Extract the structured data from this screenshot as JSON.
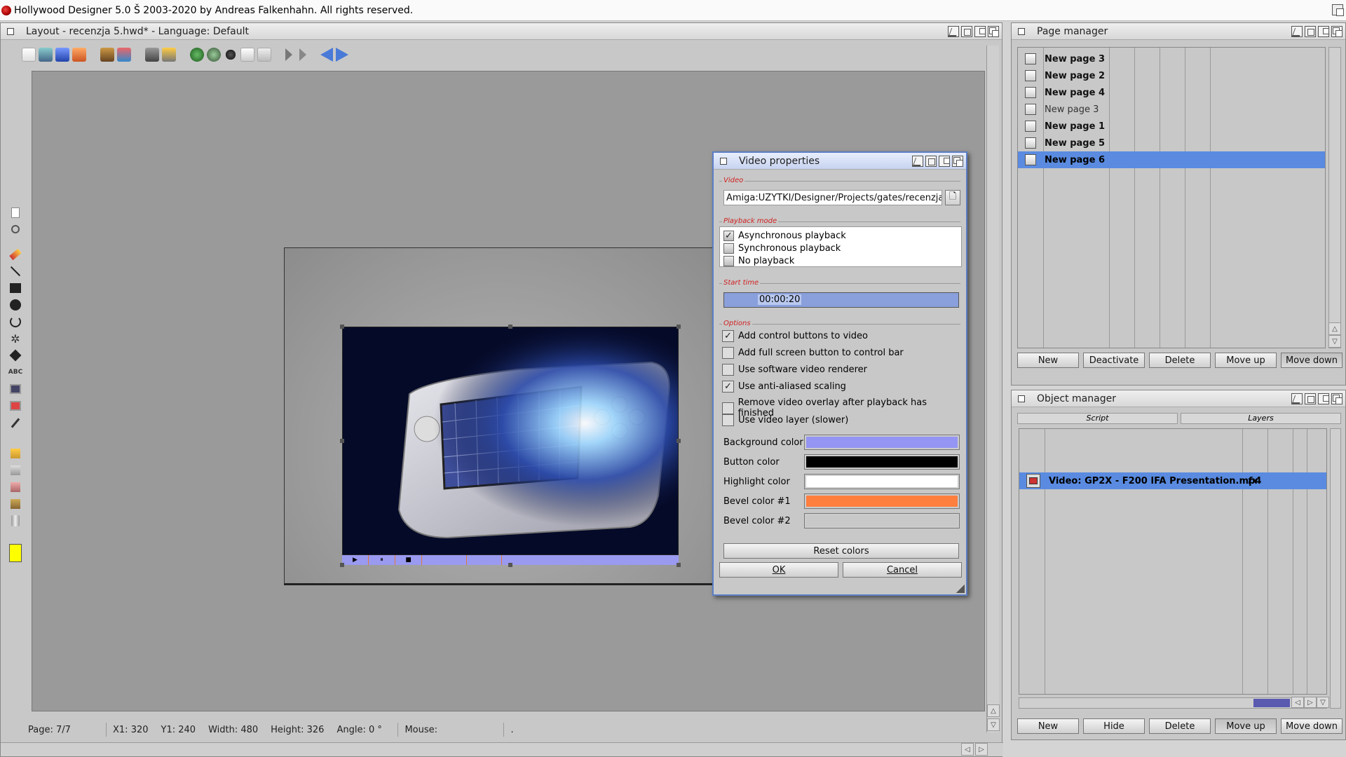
{
  "app": {
    "title": "Hollywood Designer 5.0 Š 2003-2020 by Andreas Falkenhahn. All rights reserved."
  },
  "layout": {
    "title": "Layout - recenzja 5.hwd* - Language: Default",
    "status": {
      "page": "Page:  7/7",
      "x1": "X1:  320",
      "y1": "Y1:  240",
      "width": "Width:  480",
      "height": "Height:  326",
      "angle": "Angle:  0 °",
      "mouse": "Mouse:",
      "extra": "."
    },
    "toolbar_icons": [
      "new-icon",
      "open-icon",
      "save-icon",
      "save-as-icon",
      "import-icon",
      "export-icon",
      "camera-icon",
      "snapshot-icon",
      "undo-icon",
      "redo-icon",
      "cut-icon",
      "copy-icon",
      "paste-icon",
      "play-icon",
      "play-from-icon",
      "prev-page-icon",
      "next-page-icon"
    ],
    "tool_labels": {
      "text_tool": "ABC"
    },
    "video_controls": {
      "play": "▶",
      "pause": "⏸",
      "stop": "■"
    },
    "fill_color": "#ffff00"
  },
  "page_manager": {
    "title": "Page manager",
    "pages": [
      {
        "label": "New page 3",
        "bold": true
      },
      {
        "label": "New page 2",
        "bold": true
      },
      {
        "label": "New page 4",
        "bold": true
      },
      {
        "label": "New page 3",
        "bold": false
      },
      {
        "label": "New page 1",
        "bold": true
      },
      {
        "label": "New page 5",
        "bold": true
      },
      {
        "label": "New page 6",
        "bold": true,
        "selected": true
      }
    ],
    "buttons": {
      "new": "New",
      "deactivate": "Deactivate",
      "delete": "Delete",
      "move_up": "Move up",
      "move_down": "Move down"
    }
  },
  "object_manager": {
    "title": "Object manager",
    "tabs": {
      "script": "Script",
      "layers": "Layers"
    },
    "object": {
      "label": "Video: GP2X - F200 IFA Presentation.mp4",
      "fx": "fx"
    },
    "buttons": {
      "new": "New",
      "hide": "Hide",
      "delete": "Delete",
      "move_up": "Move up",
      "move_down": "Move down"
    }
  },
  "dialog": {
    "title": "Video properties",
    "video_group": "Video",
    "video_path": "Amiga:UŻYTKI/Designer/Projects/gates/recenzja",
    "playback_group": "Playback mode",
    "playback": [
      {
        "label": "Asynchronous playback",
        "checked": true
      },
      {
        "label": "Synchronous playback",
        "checked": false
      },
      {
        "label": "No playback",
        "checked": false
      }
    ],
    "start_group": "Start time",
    "start_time": "00:00:20",
    "options_group": "Options",
    "options": [
      {
        "label": "Add control buttons to video",
        "checked": true
      },
      {
        "label": "Add full screen button to control bar",
        "checked": false
      },
      {
        "label": "Use software video renderer",
        "checked": false
      },
      {
        "label": "Use anti-aliased scaling",
        "checked": true
      },
      {
        "label": "Remove video overlay after playback has finished",
        "checked": false
      },
      {
        "label": "Use video layer (slower)",
        "checked": false
      }
    ],
    "colors": [
      {
        "label": "Background color",
        "value": "#9595f3"
      },
      {
        "label": "Button color",
        "value": "#000000"
      },
      {
        "label": "Highlight color",
        "value": "#ffffff"
      },
      {
        "label": "Bevel color #1",
        "value": "#ff7f3f"
      },
      {
        "label": "Bevel color #2",
        "value": "#c8c8c8"
      }
    ],
    "reset_button": "Reset colors",
    "ok_button": "OK",
    "cancel_button": "Cancel"
  }
}
